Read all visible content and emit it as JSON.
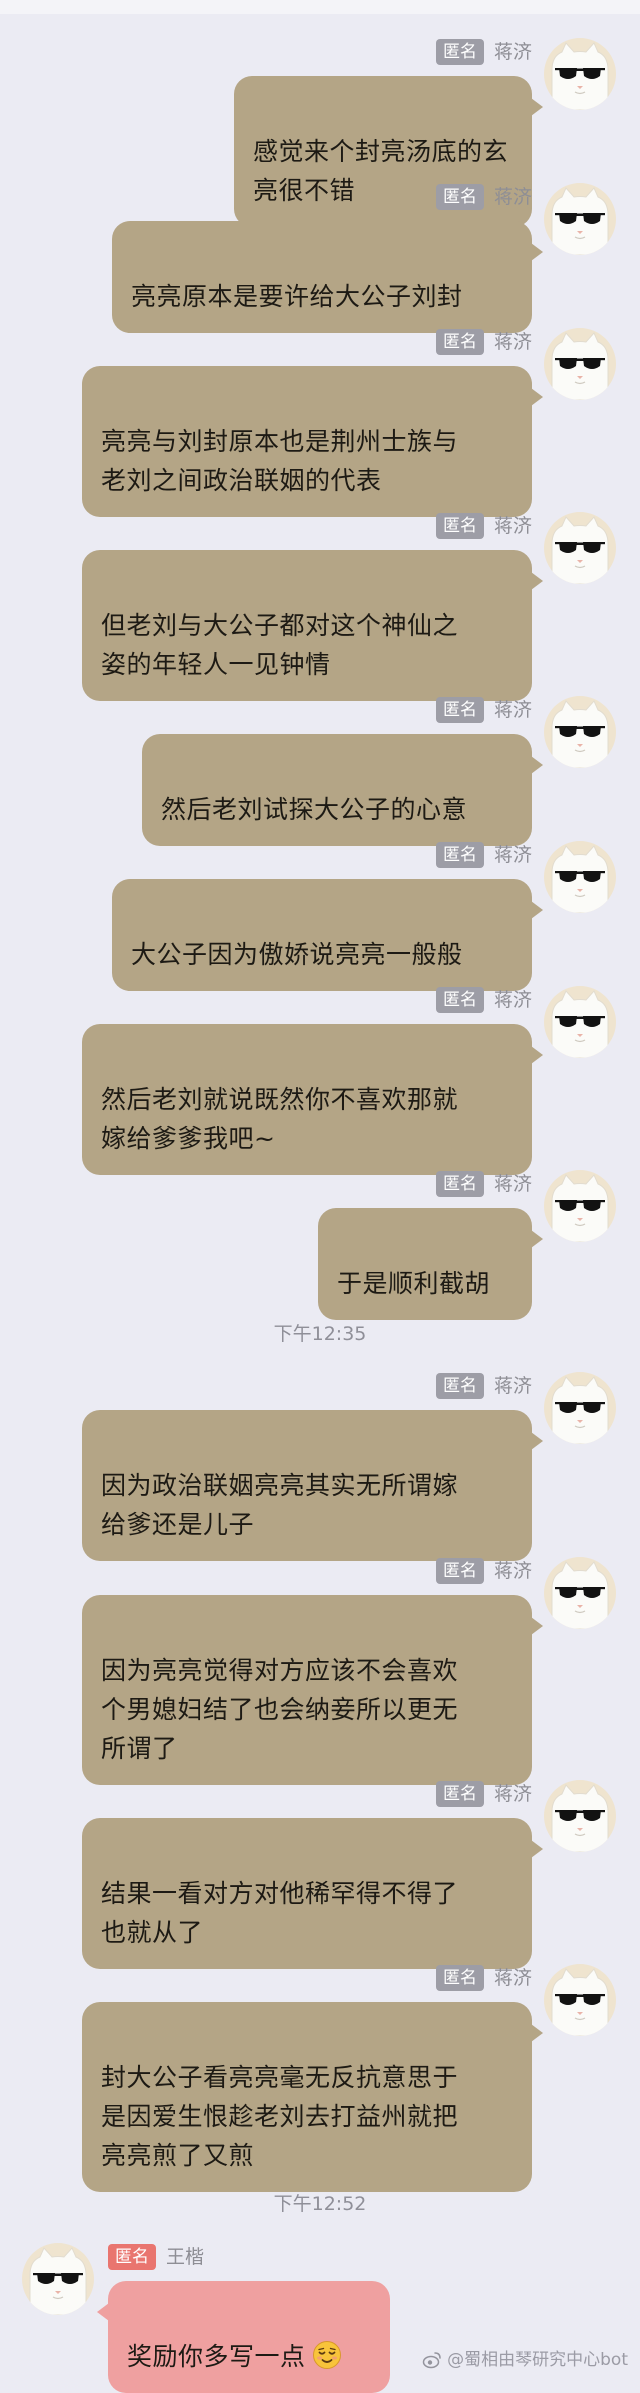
{
  "colors": {
    "background": "#ebebf3",
    "bubble_received": "#b4a586",
    "bubble_sent": "#efa0a0",
    "badge_gray": "#9d9da6",
    "badge_red": "#e9756f"
  },
  "messages": [
    {
      "badge": "匿名",
      "sender": "蒋济",
      "text": "感觉来个封亮汤底的玄亮很不错"
    },
    {
      "badge": "匿名",
      "sender": "蒋济",
      "text": "亮亮原本是要许给大公子刘封"
    },
    {
      "badge": "匿名",
      "sender": "蒋济",
      "text": "亮亮与刘封原本也是荆州士族与\n老刘之间政治联姻的代表"
    },
    {
      "badge": "匿名",
      "sender": "蒋济",
      "text": "但老刘与大公子都对这个神仙之\n姿的年轻人一见钟情"
    },
    {
      "badge": "匿名",
      "sender": "蒋济",
      "text": "然后老刘试探大公子的心意"
    },
    {
      "badge": "匿名",
      "sender": "蒋济",
      "text": "大公子因为傲娇说亮亮一般般"
    },
    {
      "badge": "匿名",
      "sender": "蒋济",
      "text": "然后老刘就说既然你不喜欢那就\n嫁给爹爹我吧~"
    },
    {
      "badge": "匿名",
      "sender": "蒋济",
      "text": "于是顺利截胡"
    },
    {
      "badge": "匿名",
      "sender": "蒋济",
      "text": "因为政治联姻亮亮其实无所谓嫁\n给爹还是儿子"
    },
    {
      "badge": "匿名",
      "sender": "蒋济",
      "text": "因为亮亮觉得对方应该不会喜欢\n个男媳妇结了也会纳妾所以更无\n所谓了"
    },
    {
      "badge": "匿名",
      "sender": "蒋济",
      "text": "结果一看对方对他稀罕得不得了\n也就从了"
    },
    {
      "badge": "匿名",
      "sender": "蒋济",
      "text": "封大公子看亮亮毫无反抗意思于\n是因爱生恨趁老刘去打益州就把\n亮亮煎了又煎"
    }
  ],
  "timestamps": [
    "下午12:35",
    "下午12:52"
  ],
  "last_message": {
    "badge": "匿名",
    "sender": "王楷",
    "text": "奖励你多写一点",
    "emoji": "relieved-face-emoji"
  },
  "watermark": "@蜀相由琴研究中心bot",
  "icons": {
    "avatar": "white-cat-with-sunglasses-avatar",
    "watermark": "weibo-icon"
  }
}
